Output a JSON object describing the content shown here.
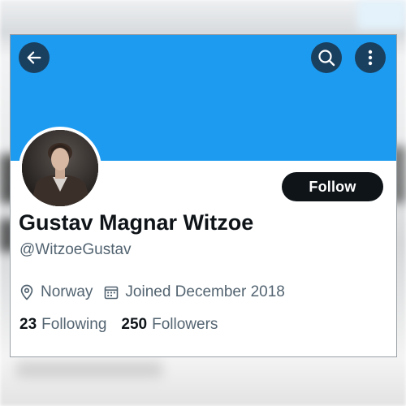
{
  "header": {
    "back_icon": "arrow-left-icon",
    "search_icon": "search-icon",
    "more_icon": "more-vertical-icon",
    "banner_color": "#1d9bf0",
    "button_bg_color": "#1a4060"
  },
  "profile": {
    "name": "Gustav Magnar Witzoe",
    "handle": "@WitzoeGustav",
    "follow_label": "Follow",
    "location": "Norway",
    "location_icon": "location-pin-icon",
    "joined": "Joined December 2018",
    "joined_icon": "calendar-icon",
    "following_count": "23",
    "following_label": "Following",
    "followers_count": "250",
    "followers_label": "Followers"
  }
}
